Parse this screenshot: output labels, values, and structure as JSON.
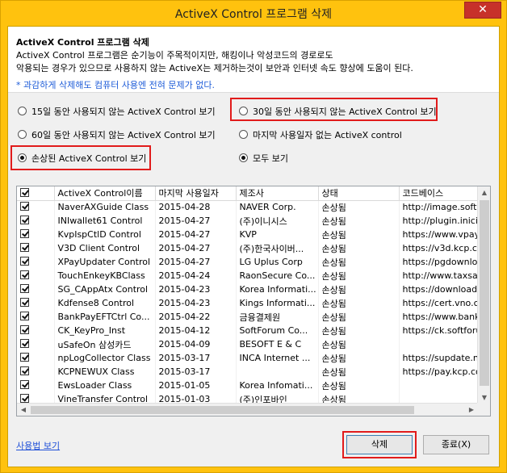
{
  "window": {
    "title": "ActiveX Control 프로그램 삭제",
    "close_glyph": "✕"
  },
  "header": {
    "title": "ActiveX Control 프로그램 삭제",
    "line1": "ActiveX Control 프로그램은 순기능이 주목적이지만, 해킹이나 악성코드의 경로로도",
    "line2": "악용되는 경우가 있으므로 사용하지 않는 ActiveX는 제거하는것이 보안과 인터넷 속도 향상에 도움이 된다.",
    "note": "* 과감하게 삭제해도 컴퓨터 사용엔 전혀 문제가 없다."
  },
  "filters": {
    "opt1": "15일 동안 사용되지 않는 ActiveX Control 보기",
    "opt2": "30일 동안 사용되지 않는 ActiveX Control 보기",
    "opt3": "60일 동안 사용되지 않는 ActiveX Control 보기",
    "opt4": "마지막 사용일자 없는 ActiveX control",
    "opt5": "손상된 ActiveX Control 보기",
    "opt6": "모두 보기"
  },
  "table": {
    "headers": [
      "ActiveX Control이름",
      "마지막 사용일자",
      "제조사",
      "상태",
      "코드베이스"
    ],
    "rows": [
      [
        "NaverAXGuide Class",
        "2015-04-28",
        "NAVER Corp.",
        "손상됨",
        "http://image.softw"
      ],
      [
        "INIwallet61 Control",
        "2015-04-27",
        "(주)이니시스",
        "손상됨",
        "http://plugin.inicis."
      ],
      [
        "KvpIspCtlD Control",
        "2015-04-27",
        "KVP",
        "손상됨",
        "https://www.vpay"
      ],
      [
        "V3D Client Control",
        "2015-04-27",
        "(주)한국사이버...",
        "손상됨",
        "https://v3d.kcp.co"
      ],
      [
        "XPayUpdater Control",
        "2015-04-27",
        "LG Uplus Corp",
        "손상됨",
        "https://pgdownloa"
      ],
      [
        "TouchEnkeyKBClass",
        "2015-04-24",
        "RaonSecure Co...",
        "손상됨",
        "http://www.taxsav"
      ],
      [
        "SG_CAppAtx Control",
        "2015-04-23",
        "Korea Informati...",
        "손상됨",
        "https://download.s"
      ],
      [
        "Kdfense8 Control",
        "2015-04-23",
        "Kings Informati...",
        "손상됨",
        "https://cert.vno.co"
      ],
      [
        "BankPayEFTCtrl Co...",
        "2015-04-22",
        "금융결제원",
        "손상됨",
        "https://www.bankp"
      ],
      [
        "CK_KeyPro_Inst",
        "2015-04-12",
        "SoftForum Co...",
        "손상됨",
        "https://ck.softforu"
      ],
      [
        "uSafeOn 삼성카드",
        "2015-04-09",
        "BESOFT E & C",
        "손상됨",
        ""
      ],
      [
        "npLogCollector Class",
        "2015-03-17",
        "INCA Internet ...",
        "손상됨",
        "https://supdate.np"
      ],
      [
        "KCPNEWUX Class",
        "2015-03-17",
        "",
        "손상됨",
        "https://pay.kcp.co"
      ],
      [
        "EwsLoader Class",
        "2015-01-05",
        "Korea Infomati...",
        "손상됨",
        ""
      ],
      [
        "VineTransfer Control",
        "2015-01-03",
        "(주)인포바인",
        "손상됨",
        ""
      ]
    ]
  },
  "footer": {
    "help_link": "사용법 보기",
    "delete_label": "삭제",
    "exit_label": "종료(X)"
  },
  "colors": {
    "frame": "#ffc20e",
    "highlight": "#e11b1b",
    "link": "#1e4fd8"
  }
}
